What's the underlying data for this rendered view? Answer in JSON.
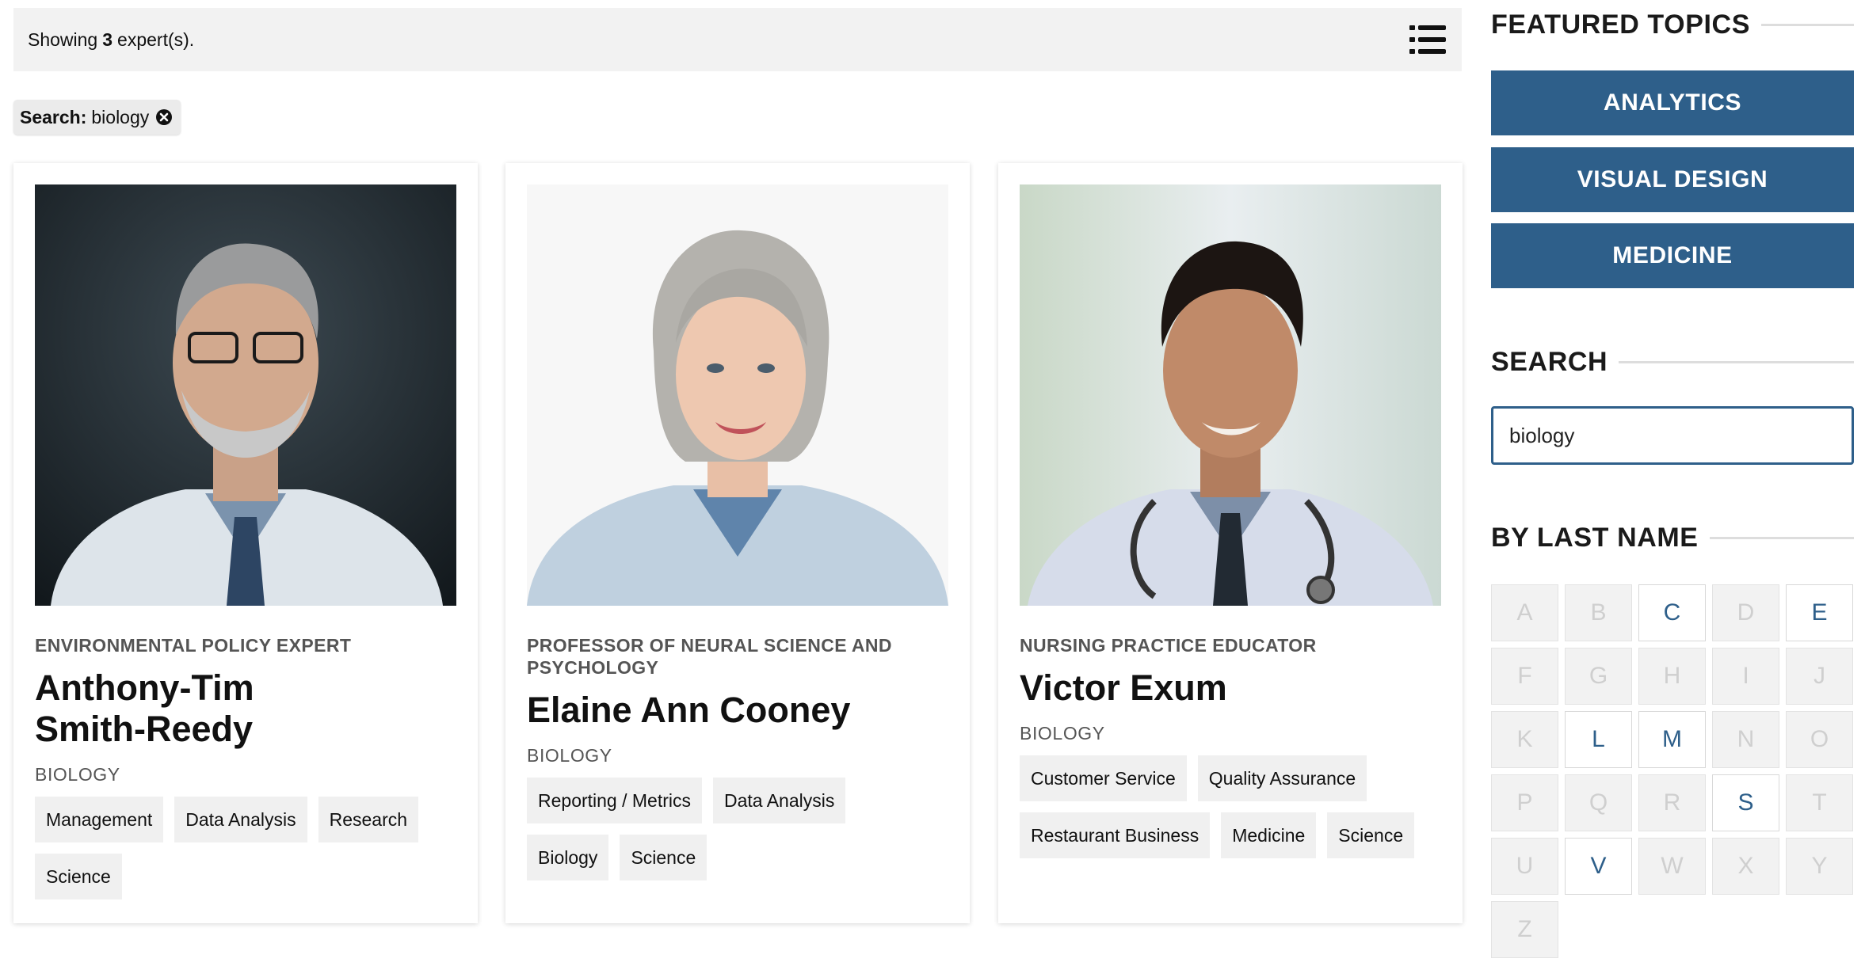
{
  "results": {
    "prefix": "Showing",
    "count": "3",
    "suffix": "expert(s).",
    "list_view_icon": "list-view-icon"
  },
  "filter_chip": {
    "key": "Search:",
    "value": "biology",
    "remove_icon": "close-circle-icon"
  },
  "experts": [
    {
      "title": "ENVIRONMENTAL POLICY EXPERT",
      "name_line1": "Anthony-Tim",
      "name_line2": "Smith-Reedy",
      "category": "BIOLOGY",
      "tags": [
        "Management",
        "Data Analysis",
        "Research",
        "Science"
      ]
    },
    {
      "title": "PROFESSOR OF NEURAL SCIENCE AND PSYCHOLOGY",
      "name": "Elaine Ann Cooney",
      "category": "BIOLOGY",
      "tags": [
        "Reporting / Metrics",
        "Data Analysis",
        "Biology",
        "Science"
      ]
    },
    {
      "title": "NURSING PRACTICE EDUCATOR",
      "name": "Victor Exum",
      "category": "BIOLOGY",
      "tags": [
        "Customer Service",
        "Quality Assurance",
        "Restaurant Business",
        "Medicine",
        "Science"
      ]
    }
  ],
  "sidebar": {
    "featured_heading": "FEATURED TOPICS",
    "topics": [
      "ANALYTICS",
      "VISUAL DESIGN",
      "MEDICINE"
    ],
    "search_heading": "SEARCH",
    "search_value": "biology",
    "lastname_heading": "BY LAST NAME",
    "letters": [
      {
        "l": "A",
        "on": false
      },
      {
        "l": "B",
        "on": false
      },
      {
        "l": "C",
        "on": true
      },
      {
        "l": "D",
        "on": false
      },
      {
        "l": "E",
        "on": true
      },
      {
        "l": "F",
        "on": false
      },
      {
        "l": "G",
        "on": false
      },
      {
        "l": "H",
        "on": false
      },
      {
        "l": "I",
        "on": false
      },
      {
        "l": "J",
        "on": false
      },
      {
        "l": "K",
        "on": false
      },
      {
        "l": "L",
        "on": true
      },
      {
        "l": "M",
        "on": true
      },
      {
        "l": "N",
        "on": false
      },
      {
        "l": "O",
        "on": false
      },
      {
        "l": "P",
        "on": false
      },
      {
        "l": "Q",
        "on": false
      },
      {
        "l": "R",
        "on": false
      },
      {
        "l": "S",
        "on": true
      },
      {
        "l": "T",
        "on": false
      },
      {
        "l": "U",
        "on": false
      },
      {
        "l": "V",
        "on": true
      },
      {
        "l": "W",
        "on": false
      },
      {
        "l": "X",
        "on": false
      },
      {
        "l": "Y",
        "on": false
      },
      {
        "l": "Z",
        "on": false
      }
    ]
  },
  "colors": {
    "accent": "#2e5f8a",
    "bar_bg": "#f2f2f2",
    "tag_bg": "#f0f0f0"
  }
}
